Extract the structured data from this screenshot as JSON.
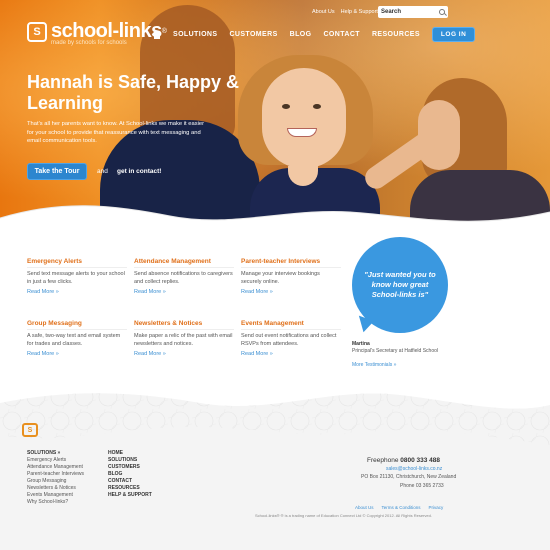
{
  "header": {
    "logo_text": "school-links",
    "logo_sup": "®",
    "logo_mark": "S",
    "tagline": "made by schools for schools",
    "toplinks": [
      "About Us",
      "Help & Support"
    ],
    "search_label": "Search",
    "nav": [
      "SOLUTIONS",
      "CUSTOMERS",
      "BLOG",
      "CONTACT",
      "RESOURCES"
    ],
    "login": "LOG IN"
  },
  "hero": {
    "title": "Hannah is Safe, Happy & Learning",
    "text": "That's all her parents want to know. At School-links we make it easier for your school to provide that reassurance with text messaging and email communication tools.",
    "tour_button": "Take the Tour",
    "and": "and",
    "contact": "get in contact!"
  },
  "features": [
    {
      "title": "Emergency Alerts",
      "text": "Send text message alerts to your school in just a few clicks.",
      "more": "Read More »"
    },
    {
      "title": "Attendance Management",
      "text": "Send absence notifications to caregivers and collect replies.",
      "more": "Read More »"
    },
    {
      "title": "Parent-teacher Interviews",
      "text": "Manage your interview bookings securely online.",
      "more": "Read More »"
    },
    {
      "title": "Group Messaging",
      "text": "A safe, two-way text and email system for trades and classes.",
      "more": "Read More »"
    },
    {
      "title": "Newsletters & Notices",
      "text": "Make paper a relic of the past with email newsletters and notices.",
      "more": "Read More »"
    },
    {
      "title": "Events Management",
      "text": "Send out event notifications and collect RSVPs from attendees.",
      "more": "Read More »"
    }
  ],
  "testimonial": {
    "quote": "\"Just wanted you to know how great School-links is\"",
    "name": "Martina",
    "role": "Principal's Secretary at Hatfield School",
    "more": "More Testimonials »"
  },
  "footer": {
    "logo_mark": "S",
    "solutions_heading": "SOLUTIONS »",
    "solutions": [
      "Emergency Alerts",
      "Attendance Management",
      "Parent-teacher Interviews",
      "Group Messaging",
      "Newsletters & Notices",
      "Events Management",
      "Why School-links?"
    ],
    "links": [
      "HOME",
      "SOLUTIONS",
      "CUSTOMERS",
      "BLOG",
      "CONTACT",
      "RESOURCES",
      "HELP & SUPPORT"
    ],
    "freephone_label": "Freephone",
    "freephone_number": "0800 333 488",
    "email": "sales@school-links.co.nz",
    "address": "PO Box 21130, Christchurch, New Zealand",
    "phone": "Phone 03 365 2733",
    "bottom_links": [
      "About Us",
      "Terms & Conditions",
      "Privacy"
    ],
    "copyright": "School-links® ® is a trading name of Education Connect Ltd © Copyright 2012. All Rights Reserved."
  }
}
